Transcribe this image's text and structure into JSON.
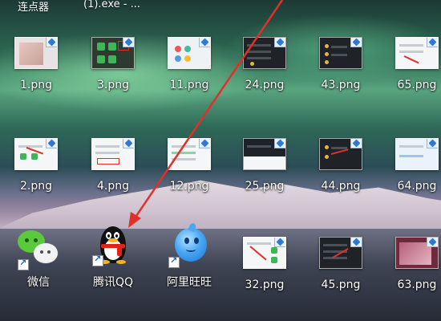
{
  "top_labels": [
    "连点器",
    "(1).exe - ..."
  ],
  "row1": [
    "1.png",
    "3.png",
    "11.png",
    "24.png",
    "43.png",
    "65.png"
  ],
  "row2": [
    "2.png",
    "4.png",
    "12.png",
    "25.png",
    "44.png",
    "64.png"
  ],
  "row3": {
    "apps": [
      "微信",
      "腾讯QQ",
      "阿里旺旺"
    ],
    "files": [
      "32.png",
      "45.png",
      "63.png"
    ]
  },
  "app_icons": [
    "wechat-icon",
    "qq-penguin-icon",
    "aliwangwang-icon"
  ],
  "colors": {
    "arrow": "#e0302a",
    "wechat_green": "#5cc83b",
    "qq_scarf": "#e2231a",
    "wangwang_blue": "#4aa8f3",
    "label_text": "#ffffff"
  }
}
